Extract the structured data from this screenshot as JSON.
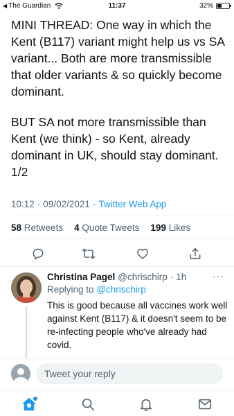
{
  "status_bar": {
    "back_app": "The Guardian",
    "time": "11:37",
    "battery": "32%",
    "battery_level": 0.32,
    "icons": [
      "back-arrow-icon",
      "signal-icon",
      "wifi-icon",
      "battery-icon"
    ]
  },
  "tweet": {
    "paragraphs": [
      "MINI THREAD: One way in which the Kent (B117) variant might help us vs SA variant... Both are more transmissible that older variants & so quickly become dominant.",
      "BUT SA not more transmissible than Kent (we think) - so Kent, already dominant in UK, should stay dominant. 1/2"
    ],
    "time": "10:12",
    "dot": "·",
    "date": "09/02/2021",
    "source": "Twitter Web App",
    "stats": {
      "retweets_count": "58",
      "retweets_label": "Retweets",
      "quotes_count": "4",
      "quotes_label": "Quote Tweets",
      "likes_count": "199",
      "likes_label": "Likes"
    },
    "actions": [
      "reply-icon",
      "retweet-icon",
      "like-icon",
      "share-icon"
    ]
  },
  "reply": {
    "name": "Christina Pagel",
    "handle": "@chrischirp",
    "dot": "·",
    "age": "1h",
    "more": "···",
    "replying_to_label": "Replying to",
    "replying_to_handle": "@chrischirp",
    "text": "This is good because all vaccines work well against Kent (B117) & it doesn't seem to be re-infecting people who've already had covid."
  },
  "composer": {
    "placeholder": "Tweet your reply"
  },
  "tab_bar": {
    "items": [
      "home-icon",
      "search-icon",
      "notifications-icon",
      "messages-icon"
    ],
    "active": "home-icon"
  },
  "colors": {
    "accent": "#1d9bf0",
    "text": "#0f1419",
    "muted": "#536471"
  }
}
